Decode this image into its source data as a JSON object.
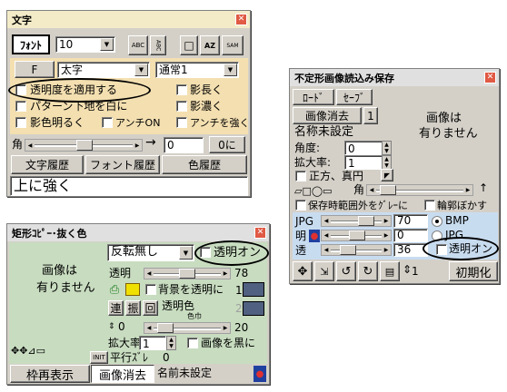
{
  "w1": {
    "title": "文字",
    "font_btn": "ﾌｫﾝﾄ",
    "size": "10",
    "f_btn": "F",
    "style": "太字",
    "mode": "通常1",
    "cb_trans": "透明度を適用する",
    "cb_pattern": "パターン下地を白に",
    "cb_shadow_bright": "影色明るく",
    "cb_antion": "アンチON",
    "cb_long": "影長く",
    "cb_dark": "影濃く",
    "cb_anti_strong": "アンチを強く",
    "angle_label": "角",
    "angle_value": "0",
    "zero_btn": "0に",
    "hist_text": "文字履歴",
    "hist_font": "フォント履歴",
    "hist_color": "色履歴",
    "text": "上に強く",
    "tool_abc": "ABC",
    "tool_vert": "ABC",
    "tool_box": "□",
    "tool_az": "AZ",
    "tool_sam": "SAM"
  },
  "w2": {
    "title": "不定形画像読込み保存",
    "load": "ﾛｰﾄﾞ",
    "save": "ｾｰﾌﾞ",
    "clear": "画像消去",
    "num": "1",
    "no_image_1": "画像は",
    "no_image_2": "有りません",
    "unset": "名称未設定",
    "angle_label": "角度:",
    "angle_value": "0",
    "zoom_label": "拡大率:",
    "zoom_value": "1",
    "cb_square": "正方、真円",
    "corner": "角",
    "cb_grey": "保存時範囲外をｸﾞﾚｰに",
    "cb_blur": "輪郭ぼかす",
    "jpg_label": "JPG",
    "jpg_value": "70",
    "bright_label": "明",
    "bright_value": "0",
    "trans_label": "透",
    "trans_value": "36",
    "rb_bmp": "BMP",
    "rb_jpg": "JPG",
    "cb_transon": "透明オン",
    "page": "1",
    "init": "初期化"
  },
  "w3": {
    "title": "矩形ｺﾋﾟｰ･抜く色",
    "flip": "反転無し",
    "cb_transon": "透明オン",
    "no_image_1": "画像は",
    "no_image_2": "有りません",
    "trans_label": "透明",
    "trans_value": "78",
    "cb_bg": "背景を透明に",
    "btn_ren": "連",
    "btn_furi": "振",
    "btn_kai": "回",
    "trans_color": "透明色",
    "color_range": "色巾",
    "idx1": "1",
    "idx2": "2",
    "spin_value": "0",
    "range_value": "20",
    "zoom_label": "拡大率",
    "zoom_value": "1",
    "cb_black": "画像を黒に",
    "init_small": "INIT",
    "shift_label": "平行ｽﾞﾚ",
    "shift_value": "0",
    "redraw": "枠再表示",
    "clear": "画像消去",
    "unset": "名前未設定"
  }
}
